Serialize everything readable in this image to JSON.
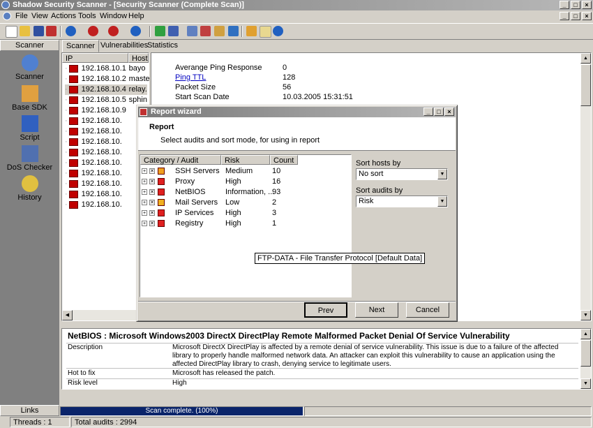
{
  "window": {
    "title": "Shadow Security Scanner - [Security Scanner (Complete Scan)]"
  },
  "menu": [
    "File",
    "View",
    "Actions",
    "Tools",
    "Window",
    "Help"
  ],
  "left_panel": {
    "header": "Scanner",
    "buttons": [
      {
        "label": "Scanner",
        "icon": "scanner-icon"
      },
      {
        "label": "Base SDK",
        "icon": "base-sdk-icon"
      },
      {
        "label": "Script",
        "icon": "script-icon"
      },
      {
        "label": "DoS Checker",
        "icon": "dos-checker-icon"
      },
      {
        "label": "History",
        "icon": "history-icon"
      }
    ],
    "footer": "Links"
  },
  "tabs": [
    "Scanner",
    "Vulnerabilities",
    "Statistics"
  ],
  "host_list": {
    "columns": [
      "IP",
      "Host"
    ],
    "rows": [
      {
        "ip": "192.168.10.1",
        "host": "bayo"
      },
      {
        "ip": "192.168.10.2",
        "host": "maste"
      },
      {
        "ip": "192.168.10.4",
        "host": "relay."
      },
      {
        "ip": "192.168.10.5",
        "host": "sphin"
      },
      {
        "ip": "192.168.10.9",
        "host": ""
      },
      {
        "ip": "192.168.10.",
        "host": ""
      },
      {
        "ip": "192.168.10.",
        "host": ""
      },
      {
        "ip": "192.168.10.",
        "host": ""
      },
      {
        "ip": "192.168.10.",
        "host": ""
      },
      {
        "ip": "192.168.10.",
        "host": ""
      },
      {
        "ip": "192.168.10.",
        "host": ""
      },
      {
        "ip": "192.168.10.",
        "host": ""
      },
      {
        "ip": "192.168.10.",
        "host": ""
      },
      {
        "ip": "192.168.10.",
        "host": ""
      }
    ]
  },
  "host_info": [
    {
      "key": "Averange Ping Response",
      "value": "0"
    },
    {
      "key": "Ping TTL",
      "value": "128"
    },
    {
      "key": "Packet Size",
      "value": "56"
    },
    {
      "key": "Start Scan Date",
      "value": "10.03.2005 15:31:51"
    }
  ],
  "dialog": {
    "title": "Report wizard",
    "heading": "Report",
    "subheading": "Select audits and sort mode, for using in report",
    "columns": [
      "Category / Audit",
      "Risk",
      "Count"
    ],
    "audits": [
      {
        "name": "SSH Servers",
        "risk": "Medium",
        "count": "10",
        "color": "#f0a020"
      },
      {
        "name": "Proxy",
        "risk": "High",
        "count": "16",
        "color": "#e02020"
      },
      {
        "name": "NetBIOS",
        "risk": "Information, ...",
        "count": "93",
        "color": "#e02020"
      },
      {
        "name": "Mail Servers",
        "risk": "Low",
        "count": "2",
        "color": "#f0b020"
      },
      {
        "name": "IP Services",
        "risk": "High",
        "count": "3",
        "color": "#e02020"
      },
      {
        "name": "Registry",
        "risk": "High",
        "count": "1",
        "color": "#e02020"
      }
    ],
    "sort_hosts_label": "Sort hosts by",
    "sort_hosts_value": "No sort",
    "sort_audits_label": "Sort audits by",
    "sort_audits_value": "Risk",
    "buttons": {
      "prev": "Prev",
      "next": "Next",
      "cancel": "Cancel"
    }
  },
  "tooltip": "FTP-DATA - File Transfer Protocol [Default Data]",
  "details": {
    "title": "NetBIOS : Microsoft Windows2003 DirectX DirectPlay Remote Malformed Packet Denial Of Service Vulnerability",
    "rows": [
      {
        "key": "Description",
        "value": "Microsoft DirectX DirectPlay is affected by a remote denial of service vulnerability. This issue is due to a failure of the affected library to properly handle malformed network data. An attacker can exploit this vulnerability to cause an application using the affected DirectPlay library to crash, denying service to legitimate users."
      },
      {
        "key": "Hot to fix",
        "value": "Microsoft has released the patch."
      },
      {
        "key": "Risk level",
        "value": "High"
      }
    ]
  },
  "status": {
    "progress_text": "Scan complete. (100%)",
    "progress": 1.0,
    "threads": "Threads : 1",
    "total_audits": "Total audits : 2994"
  }
}
